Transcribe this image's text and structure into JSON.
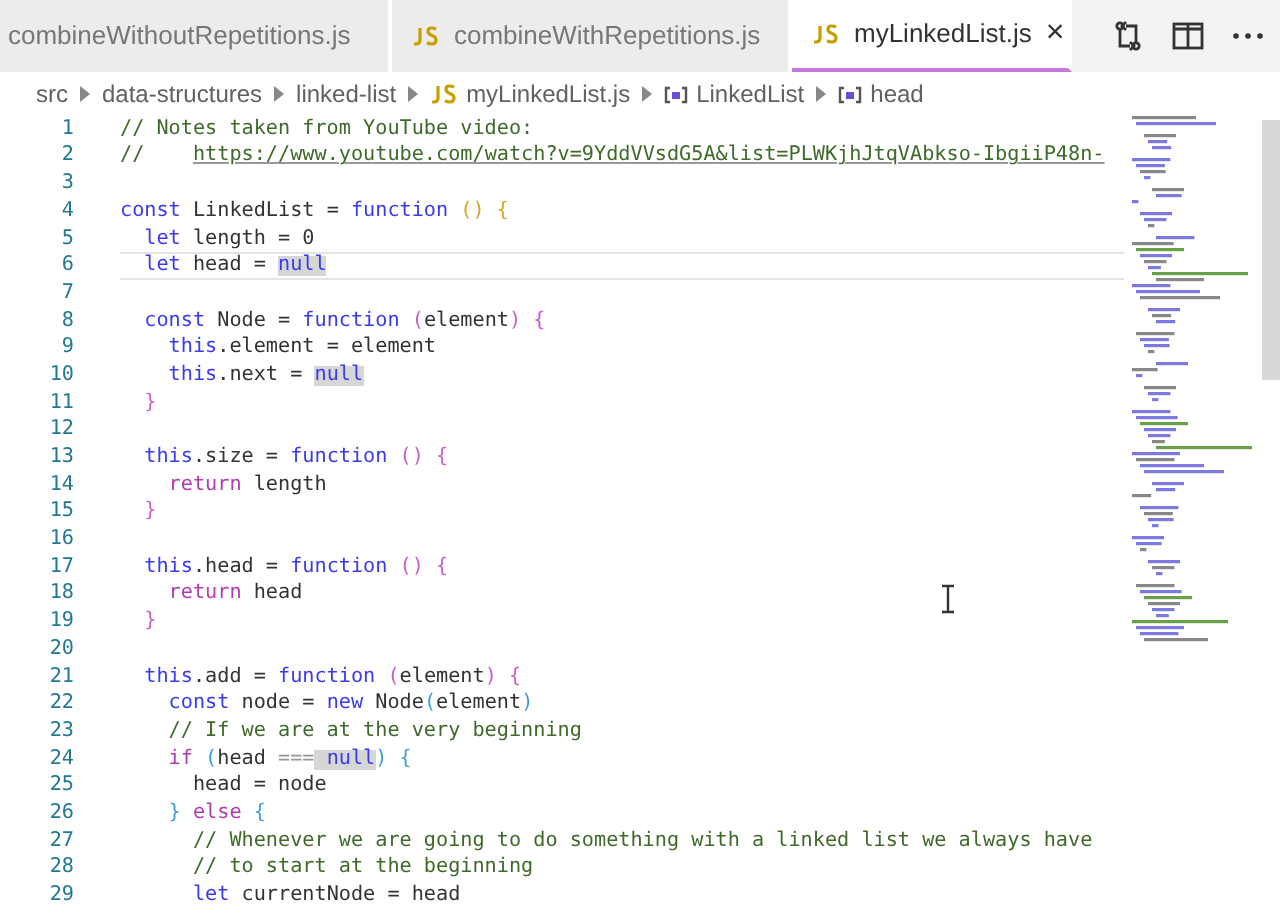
{
  "tabs": [
    {
      "label": "combineWithoutRepetitions.js",
      "icon": false,
      "selected": false
    },
    {
      "label": "combineWithRepetitions.js",
      "icon": true,
      "selected": false
    },
    {
      "label": "myLinkedList.js",
      "icon": true,
      "selected": true,
      "close": "×"
    }
  ],
  "breadcrumbs": [
    {
      "kind": "folder",
      "label": "src"
    },
    {
      "kind": "folder",
      "label": "data-structures"
    },
    {
      "kind": "folder",
      "label": "linked-list"
    },
    {
      "kind": "file",
      "label": "myLinkedList.js"
    },
    {
      "kind": "symbol",
      "label": "LinkedList"
    },
    {
      "kind": "symbol",
      "label": "head"
    }
  ],
  "editor": {
    "lines": [
      {
        "number": "1",
        "current": false,
        "tokens": [
          {
            "kind": "comment",
            "text": "// Notes taken from YouTube video:"
          }
        ]
      },
      {
        "number": "2",
        "current": false,
        "tokens": [
          {
            "kind": "comment",
            "text": "//    "
          },
          {
            "kind": "link",
            "text": "https://www.youtube.com/watch?v=9YddVVsdG5A&list=PLWKjhJtqVAbkso-IbgiiP48n-"
          }
        ]
      },
      {
        "number": "3",
        "current": false
      },
      {
        "number": "4",
        "current": false,
        "tokens": [
          {
            "kind": "keyword",
            "text": "const"
          },
          {
            "kind": "plain",
            "text": " LinkedList = "
          },
          {
            "kind": "keyword",
            "text": "function"
          },
          {
            "kind": "bracket1",
            "text": " () {"
          }
        ]
      },
      {
        "number": "5",
        "current": false,
        "tokens": [
          {
            "kind": "keyword",
            "text": "  let"
          },
          {
            "kind": "plain",
            "text": " length = 0"
          }
        ]
      },
      {
        "number": "6",
        "current": true,
        "tokens": [
          {
            "kind": "keyword",
            "text": "  let"
          },
          {
            "kind": "plain",
            "text": " head = "
          },
          {
            "kind": "match",
            "text": "null"
          }
        ]
      },
      {
        "number": "7",
        "current": false
      },
      {
        "number": "8",
        "current": false,
        "tokens": [
          {
            "kind": "keyword",
            "text": "  const"
          },
          {
            "kind": "plain",
            "text": " Node = "
          },
          {
            "kind": "keyword",
            "text": "function"
          },
          {
            "kind": "bracket2",
            "text": " ("
          },
          {
            "kind": "plain",
            "text": "element"
          },
          {
            "kind": "bracket2",
            "text": ") {"
          }
        ]
      },
      {
        "number": "9",
        "current": false,
        "tokens": [
          {
            "kind": "keyword",
            "text": "    this"
          },
          {
            "kind": "plain",
            "text": ".element = element"
          }
        ]
      },
      {
        "number": "10",
        "current": false,
        "tokens": [
          {
            "kind": "keyword",
            "text": "    this"
          },
          {
            "kind": "plain",
            "text": ".next = "
          },
          {
            "kind": "match",
            "text": "null"
          }
        ]
      },
      {
        "number": "11",
        "current": false,
        "tokens": [
          {
            "kind": "bracket2",
            "text": "  }"
          }
        ]
      },
      {
        "number": "12",
        "current": false
      },
      {
        "number": "13",
        "current": false,
        "tokens": [
          {
            "kind": "keyword",
            "text": "  this"
          },
          {
            "kind": "plain",
            "text": ".size = "
          },
          {
            "kind": "keyword",
            "text": "function"
          },
          {
            "kind": "bracket2",
            "text": " () {"
          }
        ]
      },
      {
        "number": "14",
        "current": false,
        "tokens": [
          {
            "kind": "control",
            "text": "    return"
          },
          {
            "kind": "plain",
            "text": " length"
          }
        ]
      },
      {
        "number": "15",
        "current": false,
        "tokens": [
          {
            "kind": "bracket2",
            "text": "  }"
          }
        ]
      },
      {
        "number": "16",
        "current": false
      },
      {
        "number": "17",
        "current": false,
        "tokens": [
          {
            "kind": "keyword",
            "text": "  this"
          },
          {
            "kind": "plain",
            "text": ".head = "
          },
          {
            "kind": "keyword",
            "text": "function"
          },
          {
            "kind": "bracket2",
            "text": " () {"
          }
        ]
      },
      {
        "number": "18",
        "current": false,
        "tokens": [
          {
            "kind": "control",
            "text": "    return"
          },
          {
            "kind": "plain",
            "text": " head"
          }
        ]
      },
      {
        "number": "19",
        "current": false,
        "tokens": [
          {
            "kind": "bracket2",
            "text": "  }"
          }
        ]
      },
      {
        "number": "20",
        "current": false
      },
      {
        "number": "21",
        "current": false,
        "tokens": [
          {
            "kind": "keyword",
            "text": "  this"
          },
          {
            "kind": "plain",
            "text": ".add = "
          },
          {
            "kind": "keyword",
            "text": "function"
          },
          {
            "kind": "bracket2",
            "text": " ("
          },
          {
            "kind": "plain",
            "text": "element"
          },
          {
            "kind": "bracket2",
            "text": ") {"
          }
        ]
      },
      {
        "number": "22",
        "current": false,
        "tokens": [
          {
            "kind": "keyword",
            "text": "    const"
          },
          {
            "kind": "plain",
            "text": " node = "
          },
          {
            "kind": "keyword",
            "text": "new"
          },
          {
            "kind": "plain",
            "text": " Node"
          },
          {
            "kind": "bracket3",
            "text": "("
          },
          {
            "kind": "plain",
            "text": "element"
          },
          {
            "kind": "bracket3",
            "text": ")"
          }
        ]
      },
      {
        "number": "23",
        "current": false,
        "tokens": [
          {
            "kind": "comment",
            "text": "    // If we are at the very beginning"
          }
        ]
      },
      {
        "number": "24",
        "current": false,
        "tokens": [
          {
            "kind": "control",
            "text": "    if"
          },
          {
            "kind": "bracket3",
            "text": " ("
          },
          {
            "kind": "plain",
            "text": "head "
          },
          {
            "kind": "operator",
            "text": "==="
          },
          {
            "kind": "match",
            "text": " null"
          },
          {
            "kind": "bracket3",
            "text": ") {"
          }
        ]
      },
      {
        "number": "25",
        "current": false,
        "tokens": [
          {
            "kind": "plain",
            "text": "      head = node"
          }
        ]
      },
      {
        "number": "26",
        "current": false,
        "tokens": [
          {
            "kind": "bracket3",
            "text": "    }"
          },
          {
            "kind": "control",
            "text": " else"
          },
          {
            "kind": "bracket3",
            "text": " {"
          }
        ]
      },
      {
        "number": "27",
        "current": false,
        "tokens": [
          {
            "kind": "comment",
            "text": "      // Whenever we are going to do something with a linked list we always have"
          }
        ]
      },
      {
        "number": "28",
        "current": false,
        "tokens": [
          {
            "kind": "comment",
            "text": "      // to start at the beginning"
          }
        ]
      },
      {
        "number": "29",
        "current": false,
        "tokens": [
          {
            "kind": "keyword",
            "text": "      let"
          },
          {
            "kind": "plain",
            "text": " currentNode = head"
          }
        ]
      }
    ]
  }
}
